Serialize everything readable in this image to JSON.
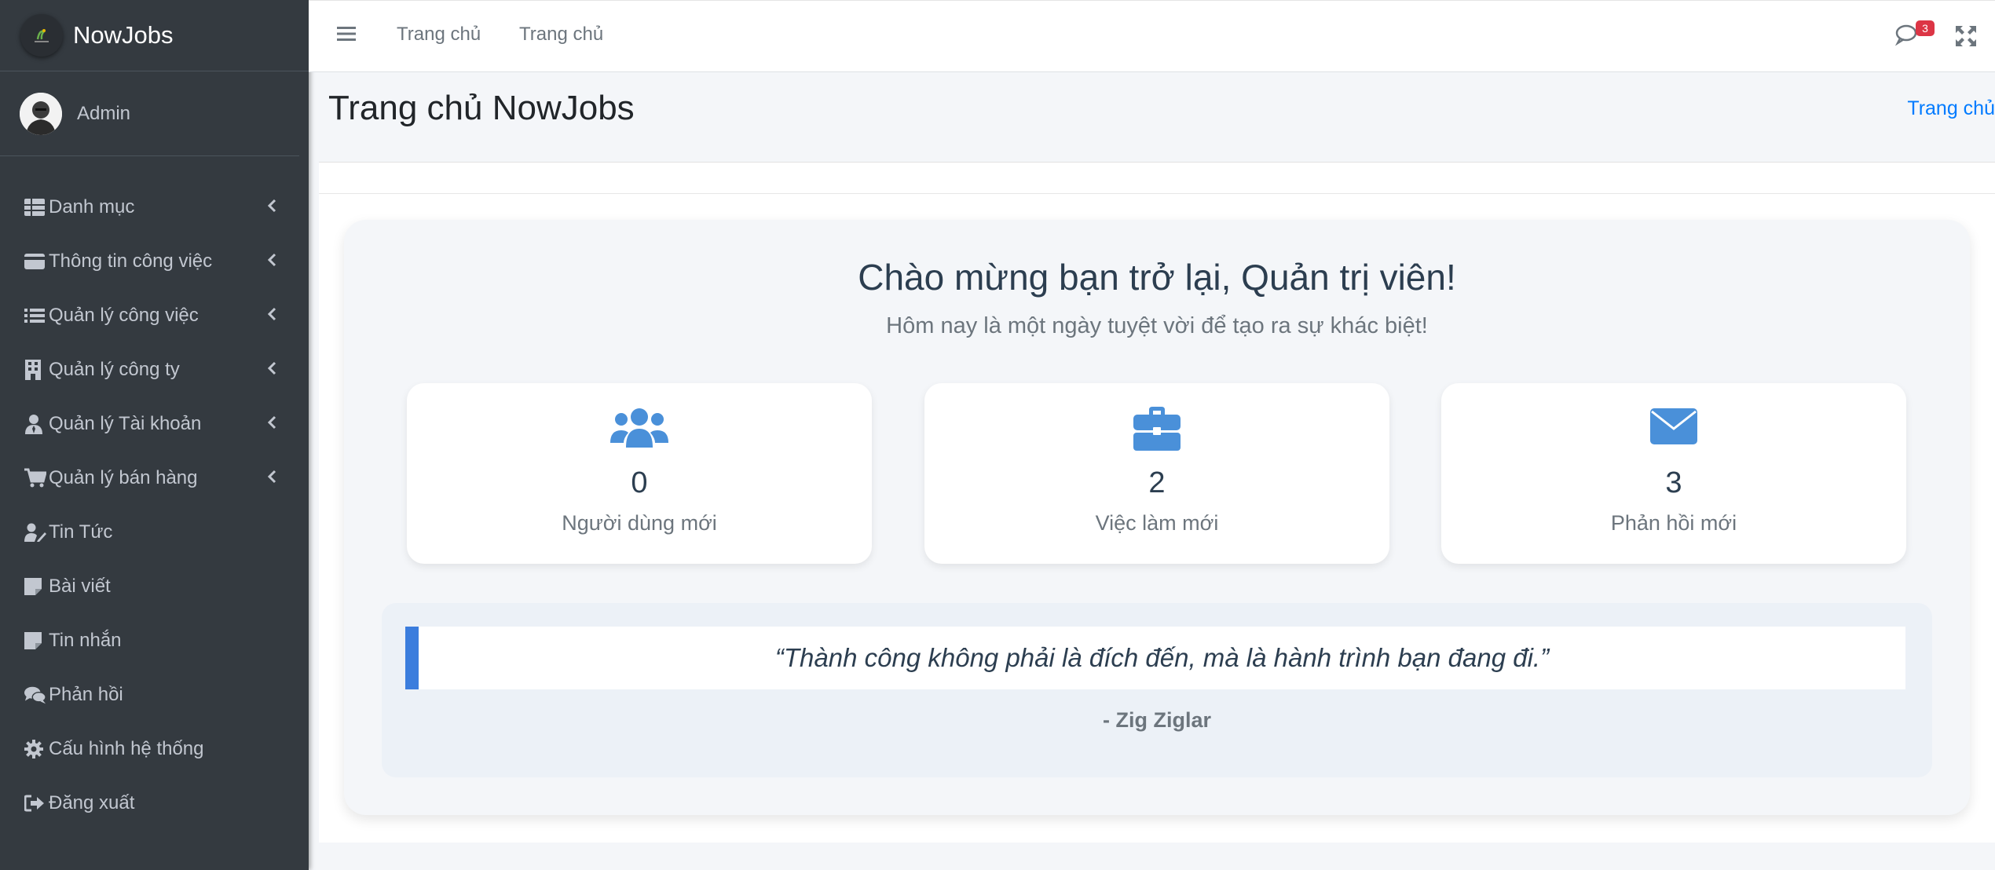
{
  "brand": {
    "name": "NowJobs",
    "logo_icon": "nowjobs-logo"
  },
  "user": {
    "name": "Admin",
    "avatar_icon": "user-avatar"
  },
  "sidebar": {
    "items": [
      {
        "label": "Danh mục",
        "icon": "table-icon",
        "has_submenu": true
      },
      {
        "label": "Thông tin công việc",
        "icon": "credit-card-icon",
        "has_submenu": true
      },
      {
        "label": "Quản lý công việc",
        "icon": "list-icon",
        "has_submenu": true
      },
      {
        "label": "Quản lý công ty",
        "icon": "building-icon",
        "has_submenu": true
      },
      {
        "label": "Quản lý Tài khoản",
        "icon": "user-tie-icon",
        "has_submenu": true
      },
      {
        "label": "Quản lý bán hàng",
        "icon": "cart-icon",
        "has_submenu": true
      },
      {
        "label": "Tin Tức",
        "icon": "user-edit-icon",
        "has_submenu": false
      },
      {
        "label": "Bài viết",
        "icon": "sticky-note-icon",
        "has_submenu": false
      },
      {
        "label": "Tin nhắn",
        "icon": "sticky-note-icon",
        "has_submenu": false
      },
      {
        "label": "Phản hồi",
        "icon": "comments-icon",
        "has_submenu": false
      },
      {
        "label": "Cấu hình hệ thống",
        "icon": "gear-icon",
        "has_submenu": false
      },
      {
        "label": "Đăng xuất",
        "icon": "sign-out-icon",
        "has_submenu": false
      }
    ]
  },
  "navbar": {
    "links": [
      "Trang chủ",
      "Trang chủ"
    ],
    "messages_badge": "3"
  },
  "header": {
    "title": "Trang chủ NowJobs",
    "breadcrumb": "Trang chủ"
  },
  "welcome": {
    "title": "Chào mừng bạn trở lại, Quản trị viên!",
    "subtitle": "Hôm nay là một ngày tuyệt vời để tạo ra sự khác biệt!",
    "stats": [
      {
        "value": "0",
        "label": "Người dùng mới",
        "icon": "users-icon"
      },
      {
        "value": "2",
        "label": "Việc làm mới",
        "icon": "briefcase-icon"
      },
      {
        "value": "3",
        "label": "Phản hồi mới",
        "icon": "envelope-icon"
      }
    ],
    "quote": "“Thành công không phải là đích đến, mà là hành trình bạn đang đi.”",
    "quote_author": "- Zig Ziglar"
  },
  "colors": {
    "sidebar_bg": "#343a40",
    "accent": "#4a90d9",
    "link": "#007bff",
    "badge": "#dc3545"
  }
}
